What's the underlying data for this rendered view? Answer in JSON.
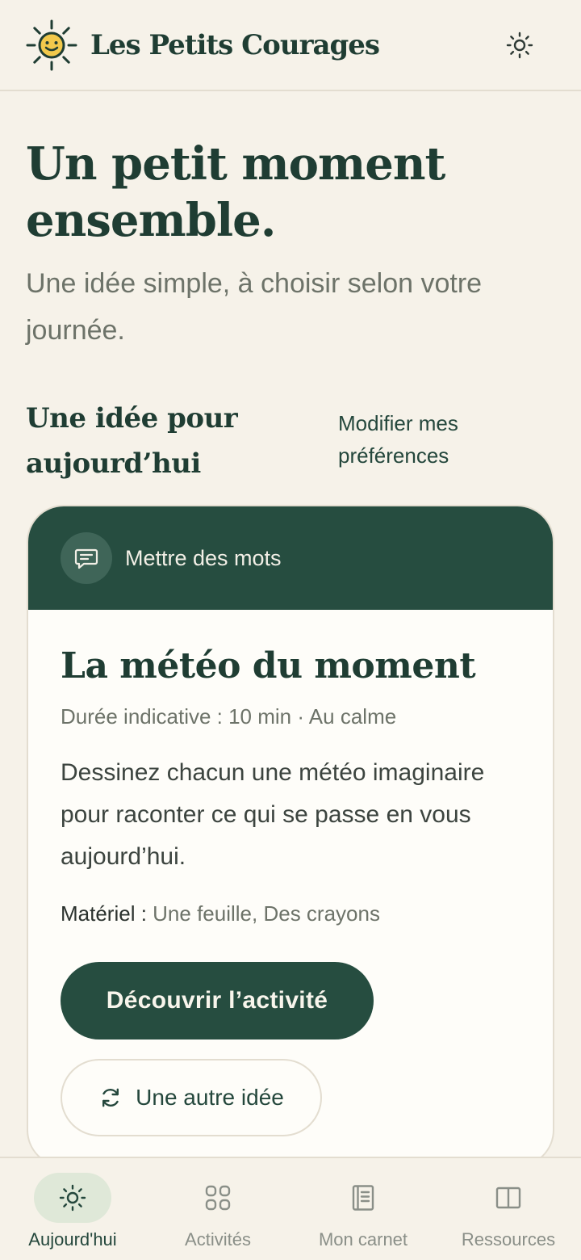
{
  "header": {
    "brand_name": "Les Petits Courages",
    "logo_icon": "smiling-sun-icon",
    "theme_toggle_icon": "sun-icon"
  },
  "hero": {
    "title": "Un petit moment ensemble.",
    "subtitle": "Une idée simple, à choisir selon votre journée."
  },
  "section": {
    "title": "Une idée pour aujourd’hui",
    "preferences_link": "Modifier mes préférences"
  },
  "activity_card": {
    "category_icon": "speech-bubble-icon",
    "category": "Mettre des mots",
    "title": "La météo du moment",
    "meta": "Durée indicative : 10 min · Au calme",
    "description": "Dessinez chacun une météo imaginaire pour raconter ce qui se passe en vous aujourd’hui.",
    "material_label": "Matériel :",
    "material_value": "Une feuille, Des crayons",
    "primary_button": "Découvrir l’activité",
    "secondary_button": "Une autre idée",
    "secondary_icon": "refresh-icon"
  },
  "bottom_nav": {
    "items": [
      {
        "label": "Aujourd'hui",
        "icon": "sun-icon",
        "active": true
      },
      {
        "label": "Activités",
        "icon": "grid-icon",
        "active": false
      },
      {
        "label": "Mon carnet",
        "icon": "notebook-icon",
        "active": false
      },
      {
        "label": "Ressources",
        "icon": "book-open-icon",
        "active": false
      }
    ]
  },
  "colors": {
    "background": "#f6f2e9",
    "primary": "#264d40",
    "card": "#fefdf9",
    "accent_yellow": "#f2c94c",
    "nav_active_pill": "#dfe8d8"
  }
}
